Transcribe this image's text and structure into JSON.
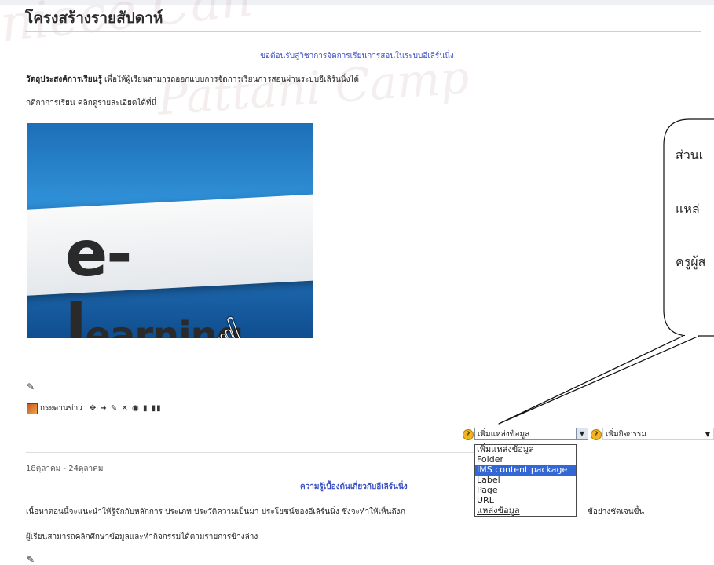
{
  "section": {
    "title": "โครงสร้างรายสัปดาห์"
  },
  "intro": {
    "welcome": "ขอต้อนรับสู่วิชาการจัดการเรียนการสอนในระบบอีเลิร์นนิ่ง",
    "objective_label": "วัตถุประสงค์การเรียนรู้",
    "objective_text": " เพื่อให้ผู้เรียนสามารถออกแบบการจัดการเรียนการสอนผ่านระบบอีเลิร์นนิ่งได้",
    "rules": "กติกาการเรียน คลิกดูรายละเอียดได้ที่นี่"
  },
  "hero": {
    "word_big": "e-l",
    "word_small": "earning..."
  },
  "news": {
    "label": "กระดานข่าว",
    "tools": "✥ ➜ ✎ ✕ ◉ ▮ ▮▮"
  },
  "controls": {
    "add_resource_selected": "เพิ่มแหล่งข้อมูล",
    "add_activity_selected": "เพิ่มกิจกรรม",
    "help_glyph": "?"
  },
  "dropdown": {
    "options": [
      "เพิ่มแหล่งข้อมูล",
      "Folder",
      "IMS content package",
      "Label",
      "Page",
      "URL",
      "แหล่งข้อมูล"
    ],
    "highlighted_index": 2
  },
  "week": {
    "date_range": "18ตุลาคม - 24ตุลาคม",
    "title": "ความรู้เบื้องต้นเกี่ยวกับอีเลิร์นนิ่ง",
    "description_1": "เนื้อหาตอนนี้จะแนะนำให้รู้จักกับหลักการ ประเภท ประวัติความเป็นมา ประโยชน์ของอีเลิร์นนิ่ง ซึ่งจะทำให้เห็นถึงภ",
    "description_1b": "ข้อย่างชัดเจนขึ้น",
    "description_2": "ผู้เรียนสามารถคลิกศึกษาข้อมูลและทำกิจกรรมได้ตามรายการข้างล่าง"
  },
  "callout": {
    "lines": [
      "ส่วนเ",
      "แหล่",
      "ครูผู้ส"
    ]
  },
  "watermark": {
    "line1": "niece Can",
    "line2": "Pattani Camp"
  },
  "colors": {
    "link_blue": "#3a4ec4",
    "highlight": "#3367d6"
  }
}
